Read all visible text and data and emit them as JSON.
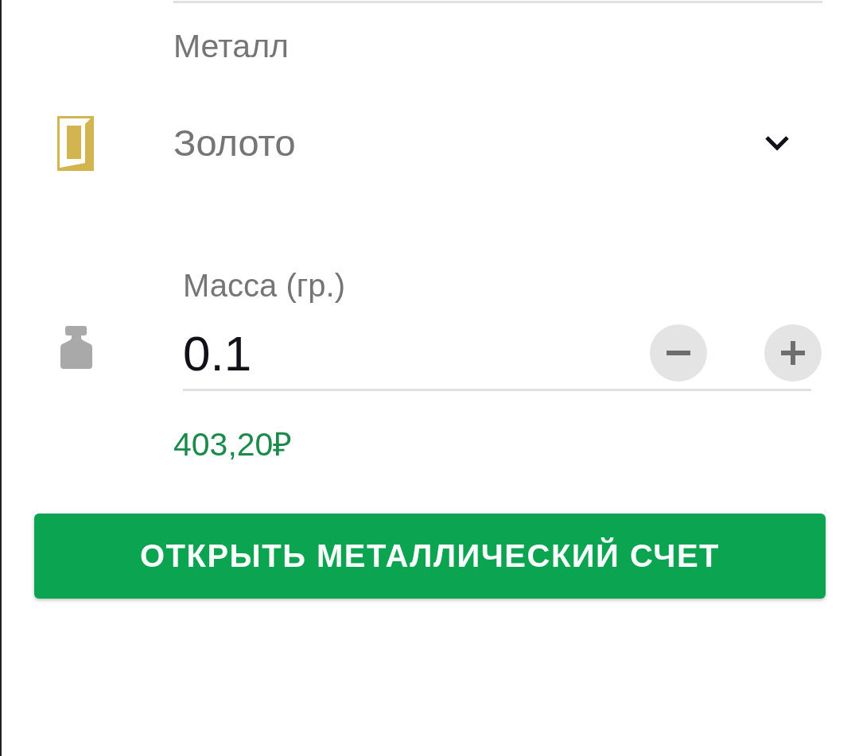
{
  "metal_field": {
    "label": "Металл",
    "value": "Золото"
  },
  "mass_field": {
    "label": "Масса (гр.)",
    "value": "0.1"
  },
  "price": "403,20₽",
  "submit_button": {
    "label": "ОТКРЫТЬ МЕТАЛЛИЧЕСКИЙ СЧЕТ"
  }
}
